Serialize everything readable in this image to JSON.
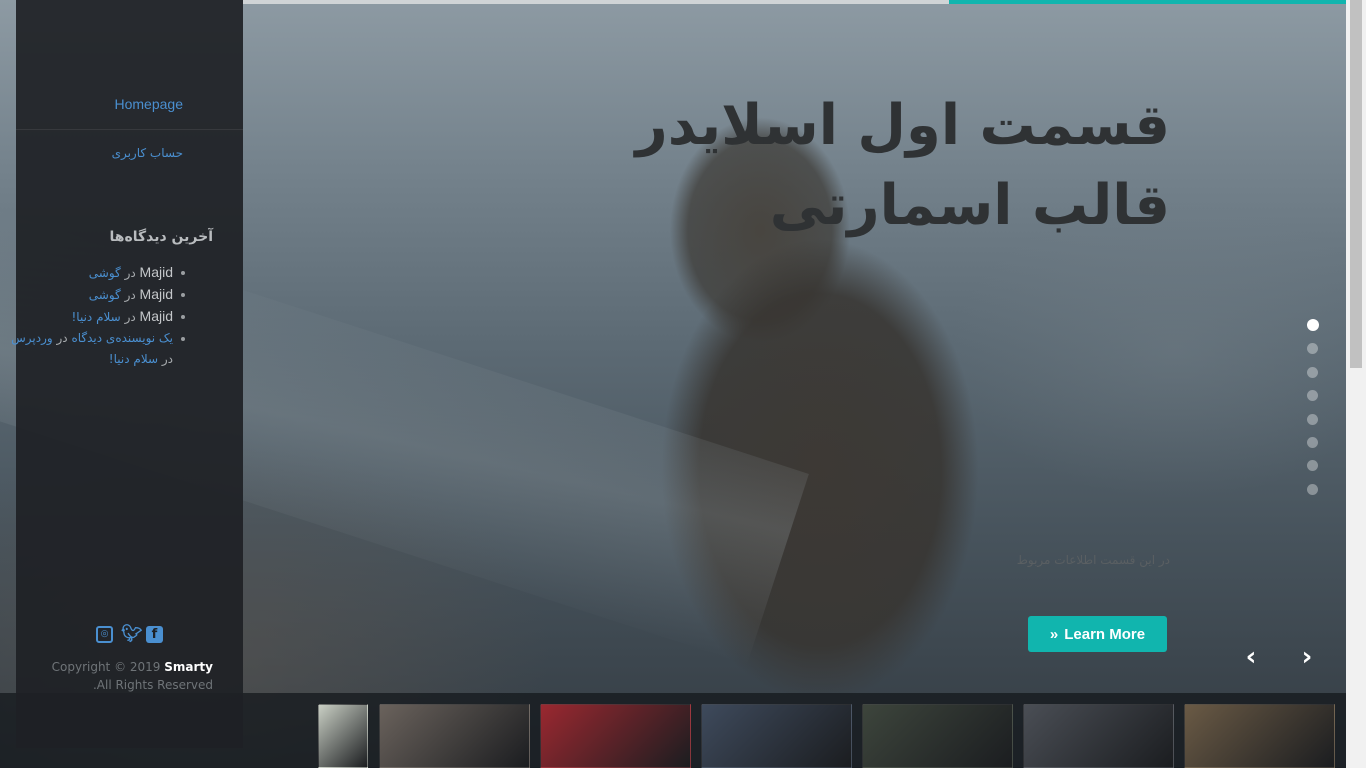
{
  "sidebar": {
    "nav": {
      "home_label": "Homepage",
      "account_label": "حساب کاربری"
    },
    "recent_comments": {
      "title": "آخرین دیدگاه‌ها",
      "items": [
        {
          "author": "Majid",
          "connector": "در",
          "post": "گوشی"
        },
        {
          "author": "Majid",
          "connector": "در",
          "post": "گوشی"
        },
        {
          "author": "Majid",
          "connector": "در",
          "post": "سلام دنیا!"
        },
        {
          "author": "یک نویسنده‌ی دیدگاه",
          "connector": "در",
          "post": "سلام دنیا!",
          "author_suffix": "وردپرس"
        }
      ]
    },
    "social": {
      "icons": [
        "instagram-icon",
        "twitter-icon",
        "facebook-icon"
      ]
    },
    "copyright": {
      "prefix": "Copyright © 2019",
      "brand": "Smarty",
      "suffix": "All Rights Reserved."
    }
  },
  "slider": {
    "title": "قسمت اول اسلایدر قالب اسمارتی",
    "subtitle": "در این قسمت اطلاعات مربوط",
    "button_label": "Learn More",
    "pagination_count": 8,
    "active_index": 0,
    "progress_fraction": 0.36
  },
  "colors": {
    "accent": "#11b5ae",
    "link": "#4a8fd0",
    "sidebar_bg": "#1e2125"
  },
  "thumbnails": [
    {
      "tone": "#c9cfc4"
    },
    {
      "tone": "#6a625c"
    },
    {
      "tone": "#9a2830"
    },
    {
      "tone": "#3e4a5c"
    },
    {
      "tone": "#3d453c"
    },
    {
      "tone": "#4a4e55"
    },
    {
      "tone": "#6a5a45"
    }
  ]
}
